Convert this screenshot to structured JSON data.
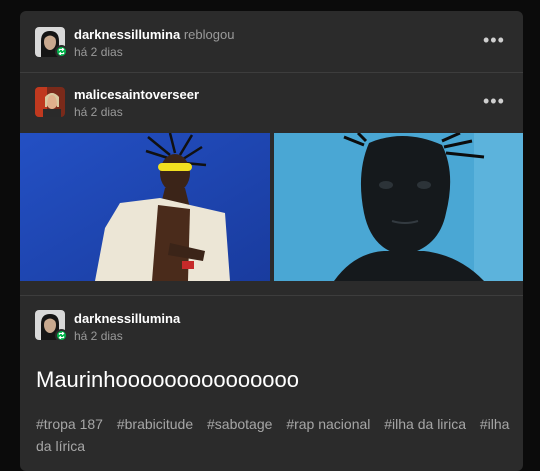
{
  "reblog_header": {
    "username": "darknessillumina",
    "action": "reblogou",
    "time": "há 2 dias",
    "menu": "•••"
  },
  "original_header": {
    "username": "malicesaintoverseer",
    "time": "há 2 dias",
    "menu": "•••"
  },
  "images": [
    {
      "icon": "photo-man-blue-wall"
    },
    {
      "icon": "photo-man-portrait"
    }
  ],
  "comment_header": {
    "username": "darknessillumina",
    "time": "há 2 dias"
  },
  "post_text": "Maurinhooooooooooooooo",
  "tags": [
    "#tropa 187",
    "#brabicitude",
    "#sabotage",
    "#rap nacional",
    "#ilha da lirica",
    "#ilha da lírica"
  ],
  "colors": {
    "background": "#0b0b0b",
    "card": "#2b2b2b",
    "reblog_badge": "#00b34a",
    "blue_image": "#1e47b8",
    "light_blue_image": "#4aa3cf"
  }
}
